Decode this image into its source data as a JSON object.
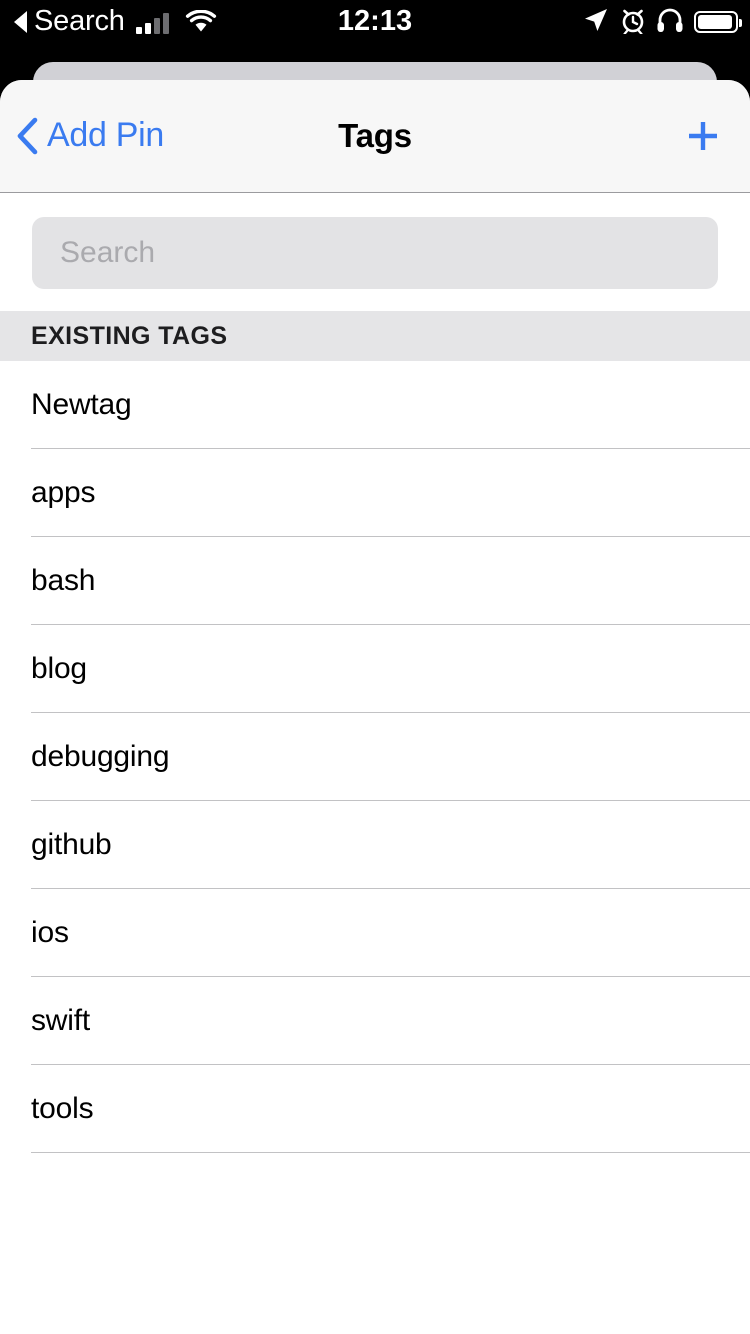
{
  "status_bar": {
    "back_affordance": "◀",
    "carrier_label": "Search",
    "signal_icon": "cellular-signal-icon",
    "wifi_icon": "wifi-icon",
    "time": "12:13",
    "location_icon": "location-arrow-icon",
    "alarm_icon": "alarm-clock-icon",
    "headphones_icon": "headphones-icon",
    "battery_icon": "battery-full-icon"
  },
  "nav_bar": {
    "back_label": "Add Pin",
    "back_icon": "chevron-left-icon",
    "title": "Tags",
    "add_icon": "plus-icon",
    "accent_color": "#3a7bf0"
  },
  "search": {
    "placeholder": "Search",
    "value": ""
  },
  "section": {
    "header": "EXISTING TAGS"
  },
  "tags": [
    {
      "label": "Newtag"
    },
    {
      "label": "apps"
    },
    {
      "label": "bash"
    },
    {
      "label": "blog"
    },
    {
      "label": "debugging"
    },
    {
      "label": "github"
    },
    {
      "label": "ios"
    },
    {
      "label": "swift"
    },
    {
      "label": "tools"
    }
  ],
  "colors": {
    "accent": "#3a7bf0",
    "navbar_bg": "#f7f7f7",
    "section_header_bg": "#e5e5e7",
    "search_bg": "#e3e3e5",
    "separator": "#c2c2c4",
    "card_behind": "#d1d1d6",
    "status_bar_bg": "#000000"
  }
}
